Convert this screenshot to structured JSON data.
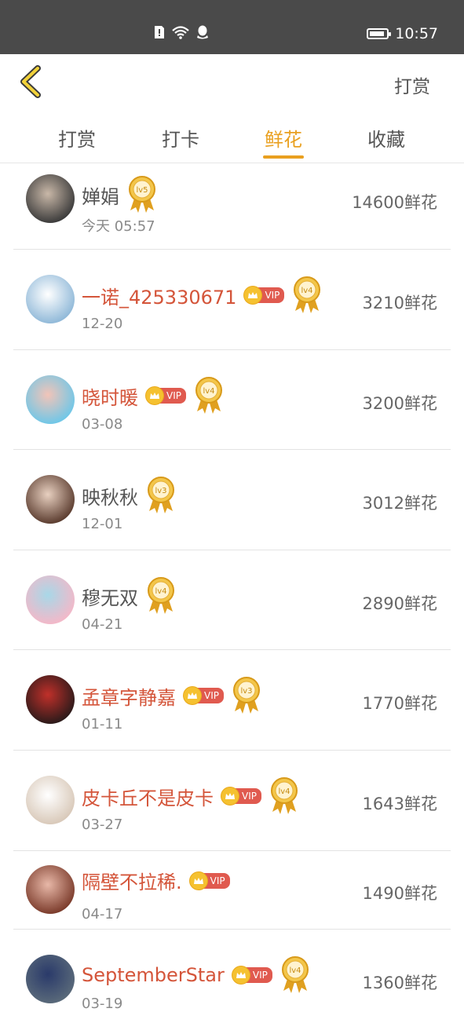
{
  "status": {
    "time": "10:57"
  },
  "nav": {
    "right_label": "打赏"
  },
  "tabs": [
    {
      "label": "打赏"
    },
    {
      "label": "打卡"
    },
    {
      "label": "鲜花"
    },
    {
      "label": "收藏"
    }
  ],
  "rows": [
    {
      "name": "婵娟",
      "vip": false,
      "level": "lv5",
      "date": "今天 05:57",
      "amount": "14600鲜花"
    },
    {
      "name": "一诺_425330671",
      "vip": true,
      "level": "lv4",
      "date": "12-20",
      "amount": "3210鲜花"
    },
    {
      "name": "晓时暖",
      "vip": true,
      "level": "lv4",
      "date": "03-08",
      "amount": "3200鲜花"
    },
    {
      "name": "映秋秋",
      "vip": false,
      "level": "lv3",
      "date": "12-01",
      "amount": "3012鲜花"
    },
    {
      "name": "穆无双",
      "vip": false,
      "level": "lv4",
      "date": "04-21",
      "amount": "2890鲜花"
    },
    {
      "name": "孟章字静嘉",
      "vip": true,
      "level": "lv3",
      "date": "01-11",
      "amount": "1770鲜花"
    },
    {
      "name": "皮卡丘不是皮卡",
      "vip": true,
      "level": "lv4",
      "date": "03-27",
      "amount": "1643鲜花"
    },
    {
      "name": "隔壁不拉稀.",
      "vip": true,
      "level": "",
      "date": "04-17",
      "amount": "1490鲜花"
    },
    {
      "name": "SeptemberStar",
      "vip": true,
      "level": "lv4",
      "date": "03-19",
      "amount": "1360鲜花"
    }
  ],
  "vip_label": "VIP",
  "colors": {
    "accent": "#e9a020",
    "vip_name": "#d4553a",
    "status_bar": "#4a4a4a"
  }
}
